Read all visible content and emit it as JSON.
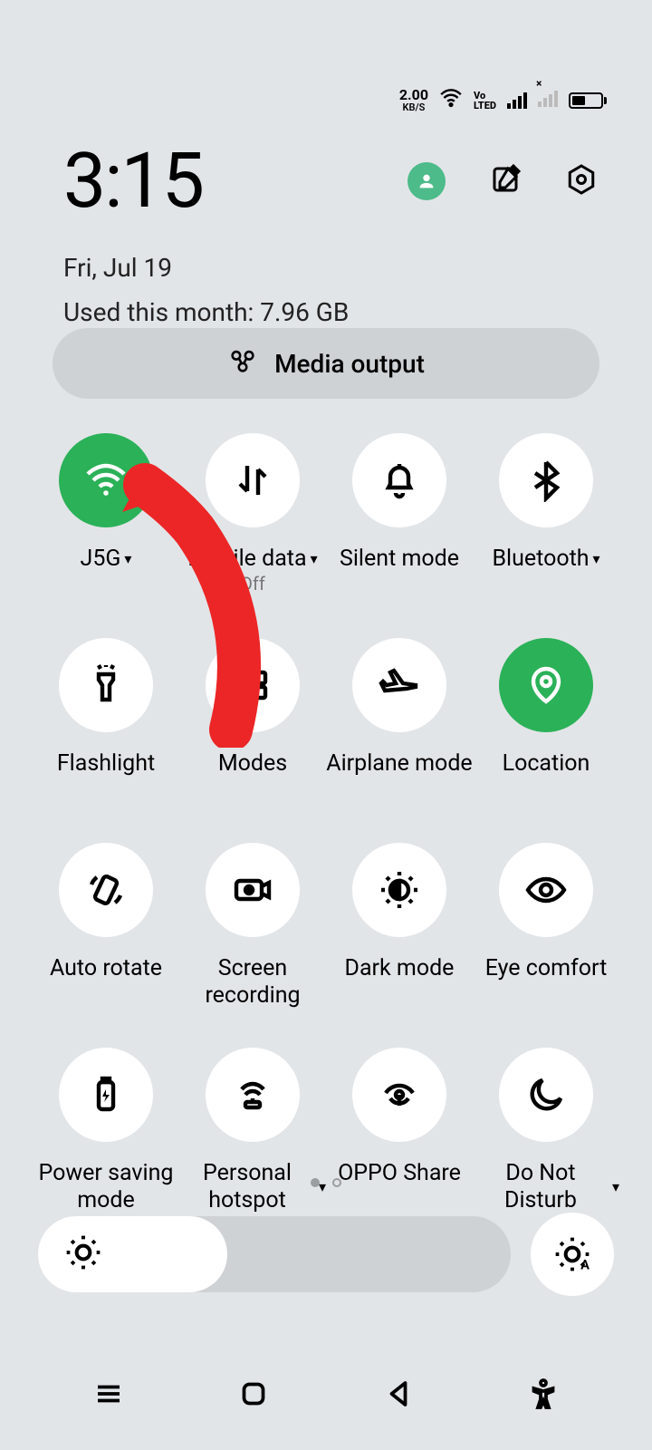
{
  "status": {
    "speed_value": "2.00",
    "speed_unit": "KB/S",
    "volte": "Vo\nLTED"
  },
  "header": {
    "time": "3:15",
    "date": "Fri, Jul 19",
    "usage": "Used this month: 7.96 GB"
  },
  "media_output": {
    "label": "Media output"
  },
  "tiles": [
    {
      "label": "J5G",
      "sub": "",
      "has_chevron": true
    },
    {
      "label": "Mobile data",
      "sub": "Off",
      "has_chevron": true
    },
    {
      "label": "Silent mode",
      "sub": "",
      "has_chevron": false
    },
    {
      "label": "Bluetooth",
      "sub": "",
      "has_chevron": true
    },
    {
      "label": "Flashlight",
      "sub": "",
      "has_chevron": false
    },
    {
      "label": "Modes",
      "sub": "",
      "has_chevron": false
    },
    {
      "label": "Airplane mode",
      "sub": "",
      "has_chevron": false
    },
    {
      "label": "Location",
      "sub": "",
      "has_chevron": false
    },
    {
      "label": "Auto rotate",
      "sub": "",
      "has_chevron": false
    },
    {
      "label": "Screen recording",
      "sub": "",
      "has_chevron": false
    },
    {
      "label": "Dark mode",
      "sub": "",
      "has_chevron": false
    },
    {
      "label": "Eye comfort",
      "sub": "",
      "has_chevron": false
    },
    {
      "label": "Power saving mode",
      "sub": "",
      "has_chevron": false
    },
    {
      "label": "Personal hotspot",
      "sub": "",
      "has_chevron": true
    },
    {
      "label": "OPPO Share",
      "sub": "",
      "has_chevron": false
    },
    {
      "label": "Do Not Disturb",
      "sub": "",
      "has_chevron": true
    }
  ],
  "colors": {
    "accent_green": "#2bb158"
  }
}
